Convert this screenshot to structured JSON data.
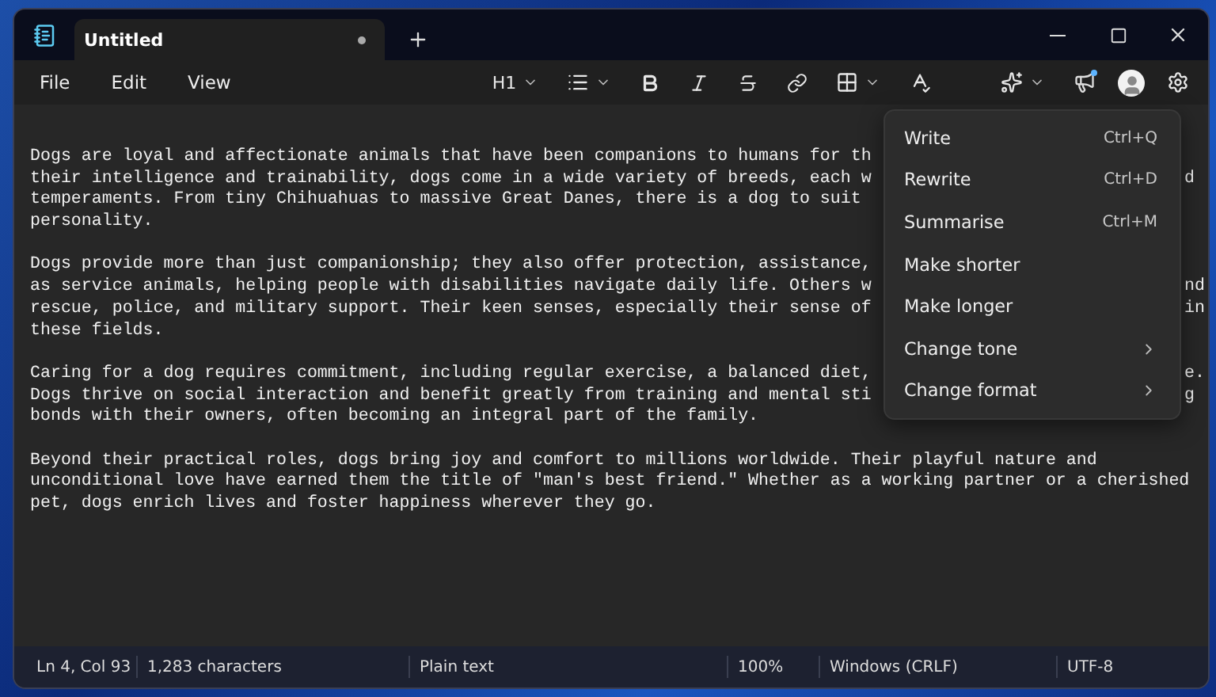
{
  "window": {
    "tab": {
      "title": "Untitled",
      "modified": true
    }
  },
  "menu_bar": [
    "File",
    "Edit",
    "View"
  ],
  "toolbar": {
    "heading": "H1"
  },
  "document": {
    "paragraphs": [
      {
        "lines": [
          {
            "text": "Dogs are loyal and affectionate animals that have been companions to humans for th"
          },
          {
            "text": "their intelligence and trainability, dogs come in a wide variety of breeds, each w",
            "tail": "d"
          },
          {
            "text": "temperaments. From tiny Chihuahuas to massive Great Danes, there is a dog to suit"
          },
          {
            "text": "personality."
          }
        ]
      },
      {
        "lines": [
          {
            "text": "Dogs provide more than just companionship; they also offer protection, assistance,"
          },
          {
            "text": "as service animals, helping people with disabilities navigate daily life. Others w",
            "tail": "nd"
          },
          {
            "text": "rescue, police, and military support. Their keen senses, especially their sense of",
            "tail": "in"
          },
          {
            "text": "these fields."
          }
        ]
      },
      {
        "lines": [
          {
            "text": "Caring for a dog requires commitment, including regular exercise, a balanced diet,",
            "tail": "e."
          },
          {
            "text": "Dogs thrive on social interaction and benefit greatly from training and mental sti",
            "tail": "g"
          },
          {
            "text": "bonds with their owners, often becoming an integral part of the family."
          }
        ]
      },
      {
        "lines": [
          {
            "text": "Beyond their practical roles, dogs bring joy and comfort to millions worldwide. Their playful nature and"
          },
          {
            "text": "unconditional love have earned them the title of \"man's best friend.\" Whether as a working partner or a cherished"
          },
          {
            "text": "pet, dogs enrich lives and foster happiness wherever they go."
          }
        ]
      }
    ]
  },
  "ai_menu": {
    "items": [
      {
        "kind": "command",
        "label": "Write",
        "shortcut": "Ctrl+Q"
      },
      {
        "kind": "command",
        "label": "Rewrite",
        "shortcut": "Ctrl+D"
      },
      {
        "kind": "command",
        "label": "Summarise",
        "shortcut": "Ctrl+M"
      },
      {
        "kind": "command",
        "label": "Make shorter"
      },
      {
        "kind": "command",
        "label": "Make longer"
      },
      {
        "kind": "submenu",
        "label": "Change tone"
      },
      {
        "kind": "submenu",
        "label": "Change format"
      }
    ]
  },
  "status_bar": [
    "Ln 4, Col 93",
    "1,283 characters",
    "Plain text",
    "100%",
    "Windows (CRLF)",
    "UTF-8"
  ]
}
